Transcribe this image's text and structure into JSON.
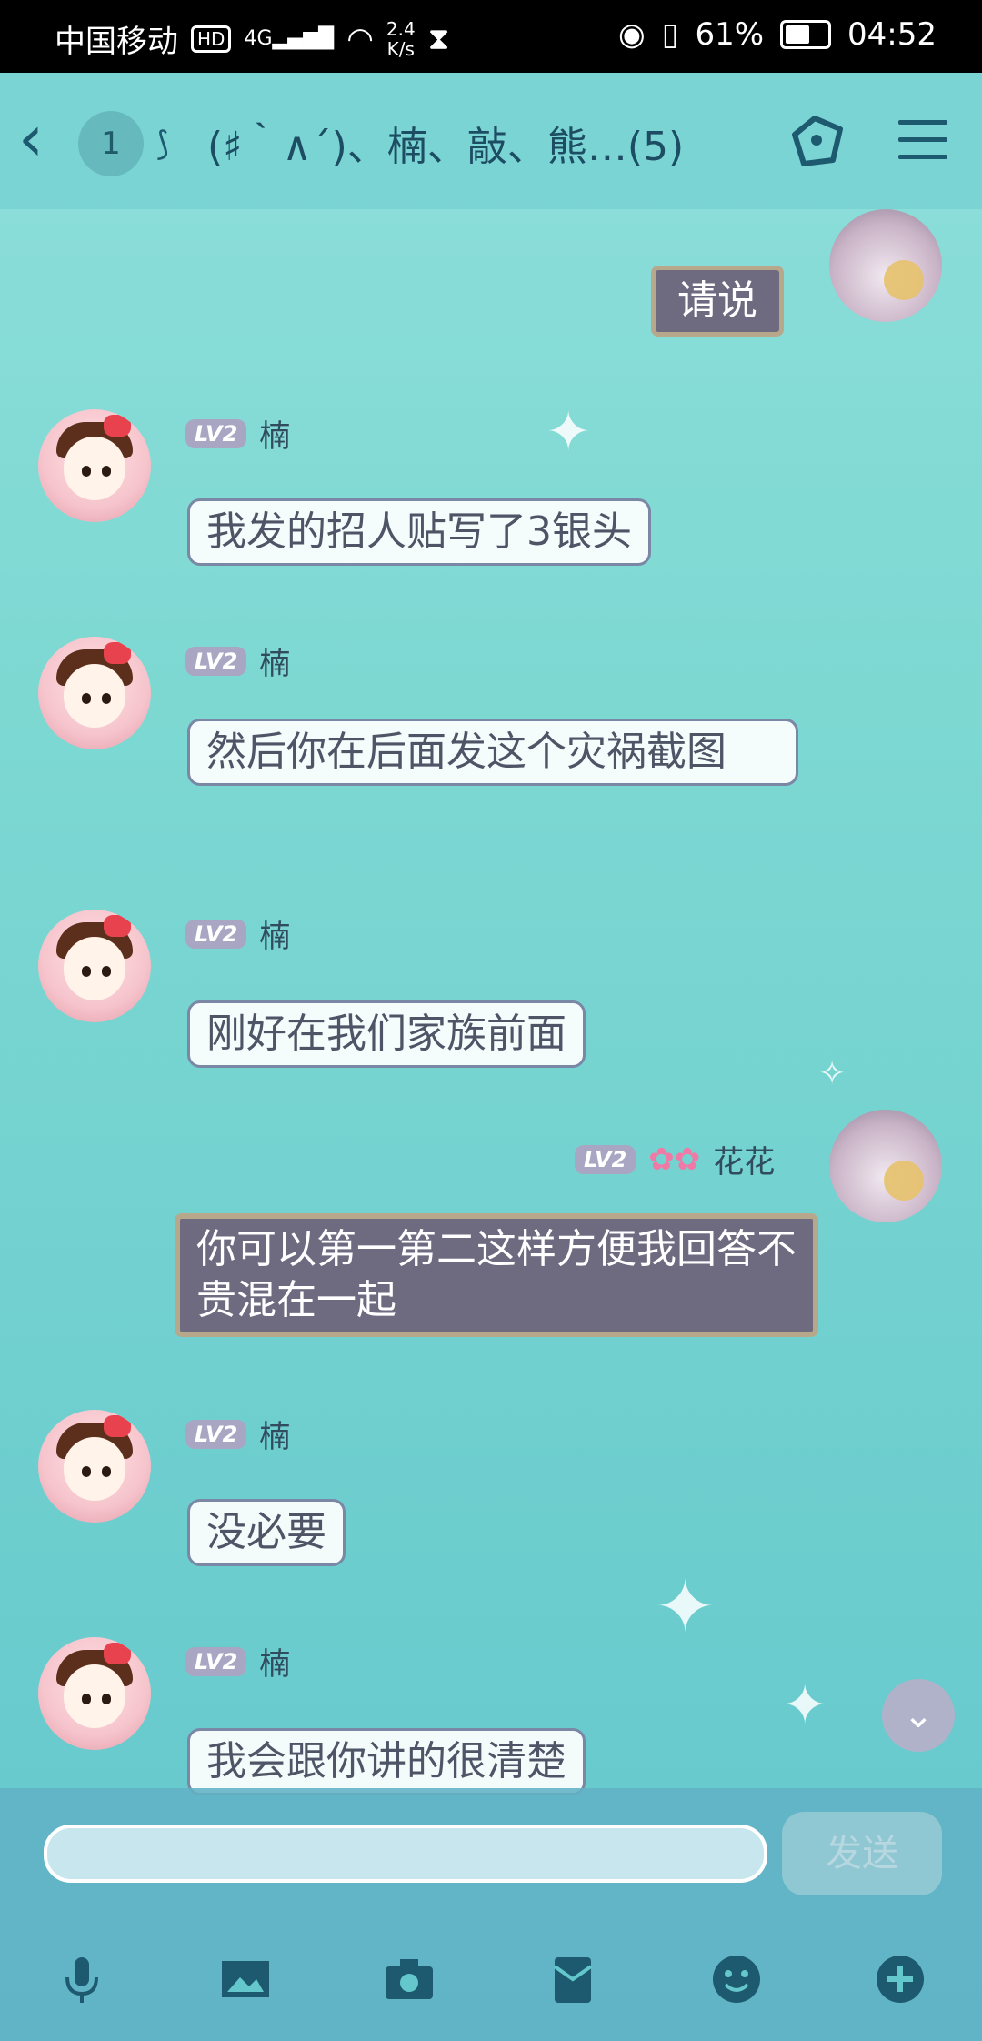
{
  "status_bar": {
    "carrier": "中国移动",
    "hd": "HD",
    "network": "4G",
    "speed_value": "2.4",
    "speed_unit": "K/s",
    "battery": "61%",
    "time": "04:52"
  },
  "header": {
    "badge": "1",
    "title": "(♯｀∧´)、楠、敲、熊…(5)"
  },
  "messages": [
    {
      "side": "left",
      "name": "楠",
      "level": "LV2",
      "text": "我发的招人贴写了3银头"
    },
    {
      "side": "left",
      "name": "楠",
      "level": "LV2",
      "text": "然后你在后面发这个灾祸截图"
    },
    {
      "side": "left",
      "name": "楠",
      "level": "LV2",
      "text": "刚好在我们家族前面"
    },
    {
      "side": "right",
      "name": "花花",
      "level": "LV2",
      "text": "你可以第一第二这样方便我回答不贵混在一起"
    },
    {
      "side": "left",
      "name": "楠",
      "level": "LV2",
      "text": "没必要"
    },
    {
      "side": "left",
      "name": "楠",
      "level": "LV2",
      "text": "我会跟你讲的很清楚"
    }
  ],
  "top_partial_message": {
    "side": "right",
    "text": "请说"
  },
  "input": {
    "placeholder": "",
    "send_label": "发送"
  },
  "toolbar_icons": [
    "microphone-icon",
    "image-icon",
    "camera-icon",
    "red-packet-icon",
    "emoji-icon",
    "plus-icon"
  ],
  "colors": {
    "accent": "#1d5a70",
    "bubble_dark": "#6e6a80"
  }
}
